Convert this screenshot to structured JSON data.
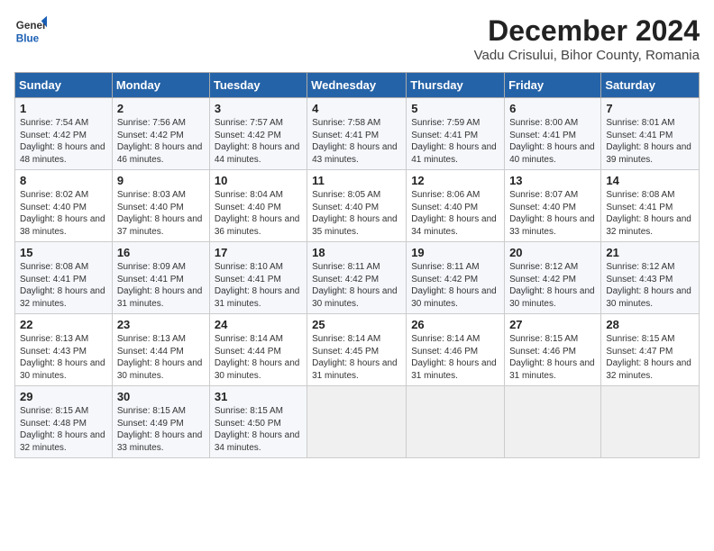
{
  "header": {
    "logo_general": "General",
    "logo_blue": "Blue",
    "title": "December 2024",
    "subtitle": "Vadu Crisului, Bihor County, Romania"
  },
  "weekdays": [
    "Sunday",
    "Monday",
    "Tuesday",
    "Wednesday",
    "Thursday",
    "Friday",
    "Saturday"
  ],
  "weeks": [
    [
      {
        "day": "1",
        "sunrise": "7:54 AM",
        "sunset": "4:42 PM",
        "daylight": "8 hours and 48 minutes."
      },
      {
        "day": "2",
        "sunrise": "7:56 AM",
        "sunset": "4:42 PM",
        "daylight": "8 hours and 46 minutes."
      },
      {
        "day": "3",
        "sunrise": "7:57 AM",
        "sunset": "4:42 PM",
        "daylight": "8 hours and 44 minutes."
      },
      {
        "day": "4",
        "sunrise": "7:58 AM",
        "sunset": "4:41 PM",
        "daylight": "8 hours and 43 minutes."
      },
      {
        "day": "5",
        "sunrise": "7:59 AM",
        "sunset": "4:41 PM",
        "daylight": "8 hours and 41 minutes."
      },
      {
        "day": "6",
        "sunrise": "8:00 AM",
        "sunset": "4:41 PM",
        "daylight": "8 hours and 40 minutes."
      },
      {
        "day": "7",
        "sunrise": "8:01 AM",
        "sunset": "4:41 PM",
        "daylight": "8 hours and 39 minutes."
      }
    ],
    [
      {
        "day": "8",
        "sunrise": "8:02 AM",
        "sunset": "4:40 PM",
        "daylight": "8 hours and 38 minutes."
      },
      {
        "day": "9",
        "sunrise": "8:03 AM",
        "sunset": "4:40 PM",
        "daylight": "8 hours and 37 minutes."
      },
      {
        "day": "10",
        "sunrise": "8:04 AM",
        "sunset": "4:40 PM",
        "daylight": "8 hours and 36 minutes."
      },
      {
        "day": "11",
        "sunrise": "8:05 AM",
        "sunset": "4:40 PM",
        "daylight": "8 hours and 35 minutes."
      },
      {
        "day": "12",
        "sunrise": "8:06 AM",
        "sunset": "4:40 PM",
        "daylight": "8 hours and 34 minutes."
      },
      {
        "day": "13",
        "sunrise": "8:07 AM",
        "sunset": "4:40 PM",
        "daylight": "8 hours and 33 minutes."
      },
      {
        "day": "14",
        "sunrise": "8:08 AM",
        "sunset": "4:41 PM",
        "daylight": "8 hours and 32 minutes."
      }
    ],
    [
      {
        "day": "15",
        "sunrise": "8:08 AM",
        "sunset": "4:41 PM",
        "daylight": "8 hours and 32 minutes."
      },
      {
        "day": "16",
        "sunrise": "8:09 AM",
        "sunset": "4:41 PM",
        "daylight": "8 hours and 31 minutes."
      },
      {
        "day": "17",
        "sunrise": "8:10 AM",
        "sunset": "4:41 PM",
        "daylight": "8 hours and 31 minutes."
      },
      {
        "day": "18",
        "sunrise": "8:11 AM",
        "sunset": "4:42 PM",
        "daylight": "8 hours and 30 minutes."
      },
      {
        "day": "19",
        "sunrise": "8:11 AM",
        "sunset": "4:42 PM",
        "daylight": "8 hours and 30 minutes."
      },
      {
        "day": "20",
        "sunrise": "8:12 AM",
        "sunset": "4:42 PM",
        "daylight": "8 hours and 30 minutes."
      },
      {
        "day": "21",
        "sunrise": "8:12 AM",
        "sunset": "4:43 PM",
        "daylight": "8 hours and 30 minutes."
      }
    ],
    [
      {
        "day": "22",
        "sunrise": "8:13 AM",
        "sunset": "4:43 PM",
        "daylight": "8 hours and 30 minutes."
      },
      {
        "day": "23",
        "sunrise": "8:13 AM",
        "sunset": "4:44 PM",
        "daylight": "8 hours and 30 minutes."
      },
      {
        "day": "24",
        "sunrise": "8:14 AM",
        "sunset": "4:44 PM",
        "daylight": "8 hours and 30 minutes."
      },
      {
        "day": "25",
        "sunrise": "8:14 AM",
        "sunset": "4:45 PM",
        "daylight": "8 hours and 31 minutes."
      },
      {
        "day": "26",
        "sunrise": "8:14 AM",
        "sunset": "4:46 PM",
        "daylight": "8 hours and 31 minutes."
      },
      {
        "day": "27",
        "sunrise": "8:15 AM",
        "sunset": "4:46 PM",
        "daylight": "8 hours and 31 minutes."
      },
      {
        "day": "28",
        "sunrise": "8:15 AM",
        "sunset": "4:47 PM",
        "daylight": "8 hours and 32 minutes."
      }
    ],
    [
      {
        "day": "29",
        "sunrise": "8:15 AM",
        "sunset": "4:48 PM",
        "daylight": "8 hours and 32 minutes."
      },
      {
        "day": "30",
        "sunrise": "8:15 AM",
        "sunset": "4:49 PM",
        "daylight": "8 hours and 33 minutes."
      },
      {
        "day": "31",
        "sunrise": "8:15 AM",
        "sunset": "4:50 PM",
        "daylight": "8 hours and 34 minutes."
      },
      null,
      null,
      null,
      null
    ]
  ]
}
